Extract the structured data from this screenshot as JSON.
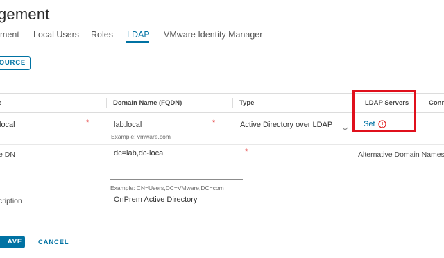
{
  "page": {
    "title": "gement"
  },
  "tabs": [
    {
      "label": "ment"
    },
    {
      "label": "Local Users"
    },
    {
      "label": "Roles"
    },
    {
      "label": "LDAP",
      "active": true
    },
    {
      "label": "VMware Identity Manager"
    }
  ],
  "toolbar": {
    "add_source_label": "OURCE"
  },
  "grid": {
    "columns": [
      {
        "label": "e"
      },
      {
        "label": "Domain Name (FQDN)"
      },
      {
        "label": "Type"
      },
      {
        "label": "LDAP Servers"
      },
      {
        "label": "Conn"
      }
    ]
  },
  "row": {
    "name_value": "local",
    "domain_value": "lab.local",
    "domain_help": "Example: vmware.com",
    "type_value": "Active Directory over LDAP",
    "ldap_servers_link": "Set",
    "required_mark": "*"
  },
  "details": {
    "base_dn_label": "e DN",
    "base_dn_value": "dc=lab,dc-local",
    "base_dn_help": "Example: CN=Users,DC=VMware,DC=com",
    "alt_domain_label": "Alternative Domain Names",
    "description_label": "cription",
    "description_value": "OnPrem Active Directory"
  },
  "actions": {
    "save_label": "AVE",
    "cancel_label": "CANCEL"
  },
  "colors": {
    "accent": "#0072a3",
    "required": "#e02020",
    "highlight": "#e0101c"
  },
  "icons": {
    "ldap_servers_status": "exclamation-circle-icon",
    "type_dropdown": "chevron-down-icon"
  }
}
